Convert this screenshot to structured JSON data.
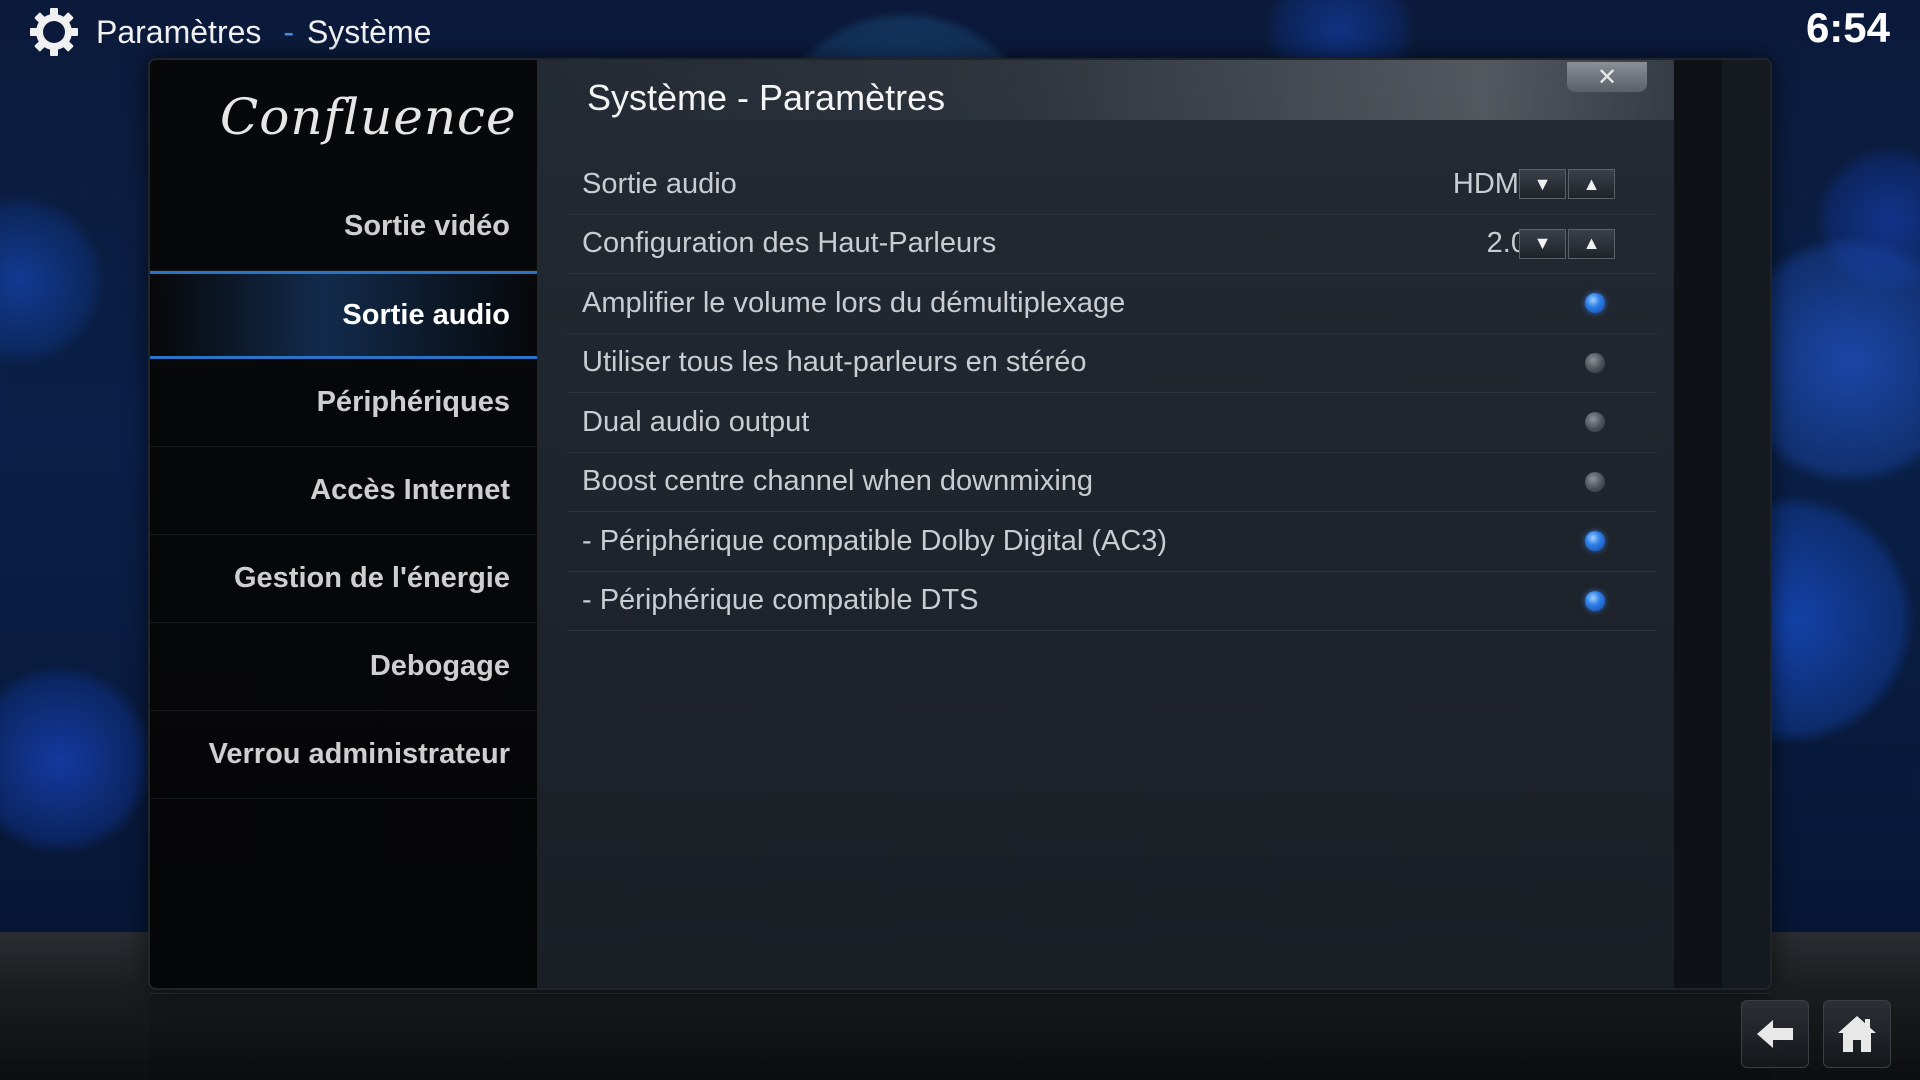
{
  "header": {
    "section": "Paramètres",
    "separator": "-",
    "subsection": "Système",
    "icon": "gear-icon",
    "clock": "6:54"
  },
  "sidebar": {
    "logo": "Confluence",
    "items": [
      {
        "label": "Sortie vidéo",
        "active": false
      },
      {
        "label": "Sortie audio",
        "active": true
      },
      {
        "label": "Périphériques",
        "active": false
      },
      {
        "label": "Accès Internet",
        "active": false
      },
      {
        "label": "Gestion de l'énergie",
        "active": false
      },
      {
        "label": "Debogage",
        "active": false
      },
      {
        "label": "Verrou administrateur",
        "active": false
      }
    ]
  },
  "dialog": {
    "title": "Système - Paramètres",
    "close_label": "✕"
  },
  "settings": [
    {
      "label": "Sortie audio",
      "type": "spinner",
      "value": "HDMI"
    },
    {
      "label": "Configuration des Haut-Parleurs",
      "type": "spinner",
      "value": "2.0"
    },
    {
      "label": "Amplifier le volume lors du démultiplexage",
      "type": "radio",
      "on": true
    },
    {
      "label": "Utiliser tous les haut-parleurs en stéréo",
      "type": "radio",
      "on": false
    },
    {
      "label": "Dual audio output",
      "type": "radio",
      "on": false
    },
    {
      "label": "Boost centre channel when downmixing",
      "type": "radio",
      "on": false
    },
    {
      "label": "- Périphérique compatible Dolby Digital (AC3)",
      "type": "radio",
      "on": true
    },
    {
      "label": "- Périphérique compatible DTS",
      "type": "radio",
      "on": true
    }
  ],
  "spinner": {
    "down_glyph": "▼",
    "up_glyph": "▲"
  },
  "footer": {
    "back_icon": "back-arrow-icon",
    "home_icon": "home-icon"
  },
  "colors": {
    "accent": "#2a74c8",
    "radio_on": "#2d7fe6",
    "radio_off": "#4a5057"
  }
}
